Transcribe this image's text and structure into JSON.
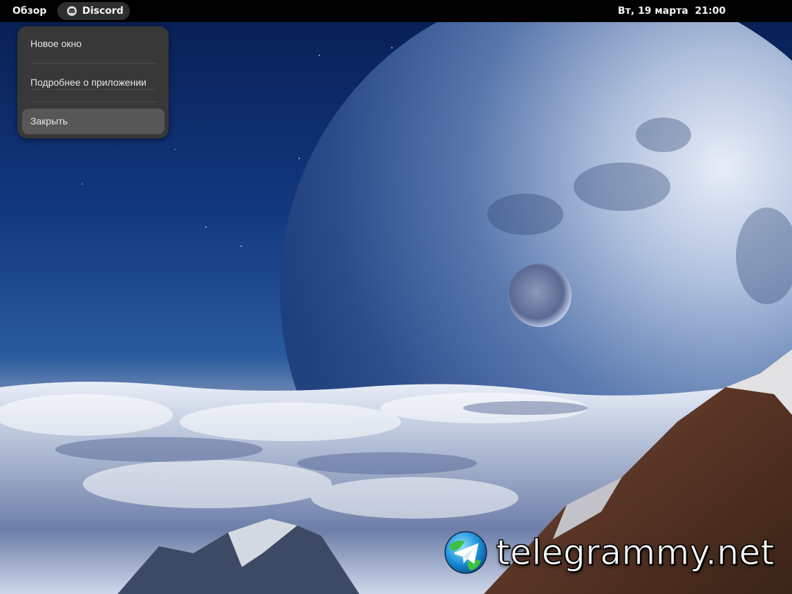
{
  "top_bar": {
    "activities_label": "Обзор",
    "app_name": "Discord",
    "app_icon": "discord-icon",
    "clock_text": "Вт, 19 марта  21:00"
  },
  "app_menu": {
    "items": [
      {
        "label": "Новое окно",
        "highlighted": false
      },
      {
        "label": "Подробнее о приложении",
        "highlighted": false
      },
      {
        "label": "Закрыть",
        "highlighted": true
      }
    ]
  },
  "watermark": {
    "text": "telegrammy.net",
    "logo": "telegram-globe-logo"
  },
  "colors": {
    "top_bar": "#000000",
    "menu_bg": "#383838",
    "menu_highlight": "#575757",
    "wallpaper_sky": "#163f86"
  }
}
